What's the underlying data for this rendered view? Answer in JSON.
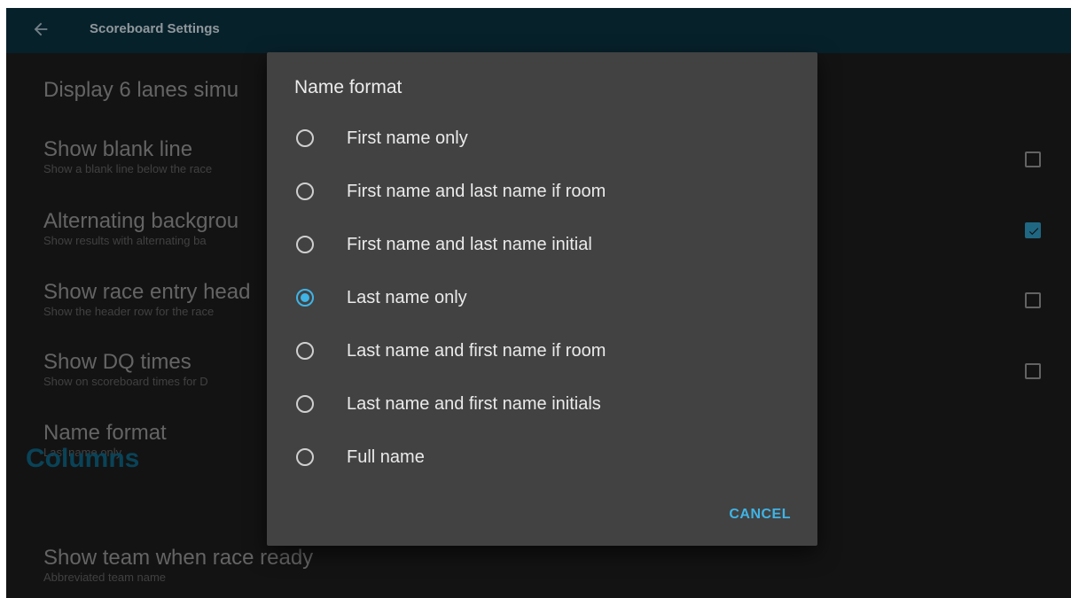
{
  "appbar": {
    "title": "Scoreboard Settings",
    "back_icon": "arrow-left-icon"
  },
  "settings": [
    {
      "title": "Display 6 lanes simu",
      "summary": ""
    },
    {
      "title": "Show blank line",
      "summary": "Show a blank line below the race",
      "checked": false
    },
    {
      "title": "Alternating backgrou",
      "summary": "Show results with alternating ba",
      "checked": true
    },
    {
      "title": "Show race entry head",
      "summary": "Show the header row for the race",
      "checked": false
    },
    {
      "title": "Show DQ times",
      "summary": "Show on scoreboard times for D",
      "checked": false
    },
    {
      "title": "Name format",
      "summary": "Last name only"
    },
    {
      "title": "Show team when race ready",
      "summary": "Abbreviated team name"
    }
  ],
  "section": {
    "label": "Columns"
  },
  "dialog": {
    "title": "Name format",
    "options": [
      {
        "label": "First name only",
        "selected": false
      },
      {
        "label": "First name and last name if room",
        "selected": false
      },
      {
        "label": "First name and last name initial",
        "selected": false
      },
      {
        "label": "Last name only",
        "selected": true
      },
      {
        "label": "Last name and first name if room",
        "selected": false
      },
      {
        "label": "Last name and first name initials",
        "selected": false
      },
      {
        "label": "Full name",
        "selected": false
      }
    ],
    "cancel_label": "CANCEL"
  },
  "colors": {
    "appbar": "#0b2e3c",
    "accent": "#3fb4e6",
    "dialog": "#424242",
    "section": "#0d5d7a"
  }
}
